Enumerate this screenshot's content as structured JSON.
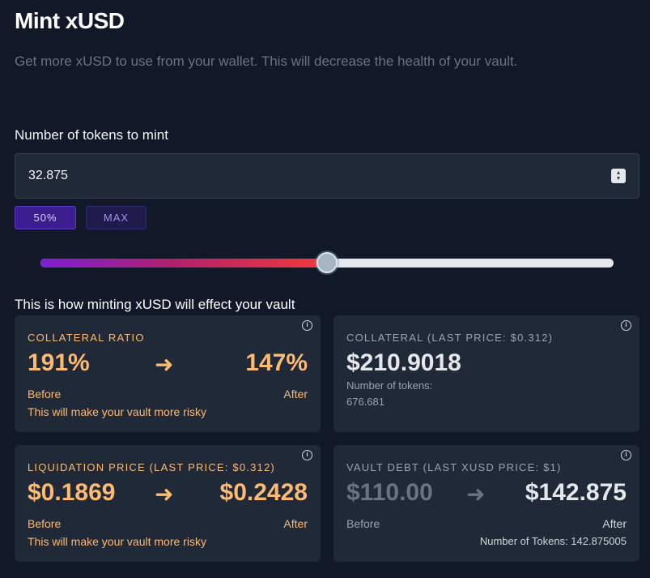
{
  "page": {
    "title": "Mint xUSD",
    "subtitle": "Get more xUSD to use from your wallet. This will decrease the health of your vault."
  },
  "mint_form": {
    "label": "Number of tokens to mint",
    "value": "32.875",
    "buttons": {
      "half": "50%",
      "max": "MAX"
    },
    "slider_fraction": 0.5
  },
  "effects": {
    "label": "This is how minting xUSD will effect your vault",
    "collateral_ratio": {
      "heading": "COLLATERAL RATIO",
      "before": "191%",
      "after": "147%",
      "before_label": "Before",
      "after_label": "After",
      "note": "This will make your vault more risky"
    },
    "collateral": {
      "heading": "COLLATERAL (LAST PRICE: $0.312)",
      "value": "$210.9018",
      "tokens_label": "Number of tokens:",
      "tokens_value": "676.681"
    },
    "liquidation_price": {
      "heading": "LIQUIDATION PRICE (LAST PRICE: $0.312)",
      "before": "$0.1869",
      "after": "$0.2428",
      "before_label": "Before",
      "after_label": "After",
      "note": "This will make your vault more risky"
    },
    "vault_debt": {
      "heading": "VAULT DEBT (LAST XUSD PRICE: $1)",
      "before": "$110.00",
      "after": "$142.875",
      "before_label": "Before",
      "after_label": "After",
      "tokens_note": "Number of Tokens: 142.875005"
    }
  },
  "icons": {
    "info": "i",
    "arrow": "➜",
    "arrow_muted": "➜"
  },
  "colors": {
    "accent_orange": "#fdba74",
    "background": "#111827",
    "card": "#1f2937"
  }
}
